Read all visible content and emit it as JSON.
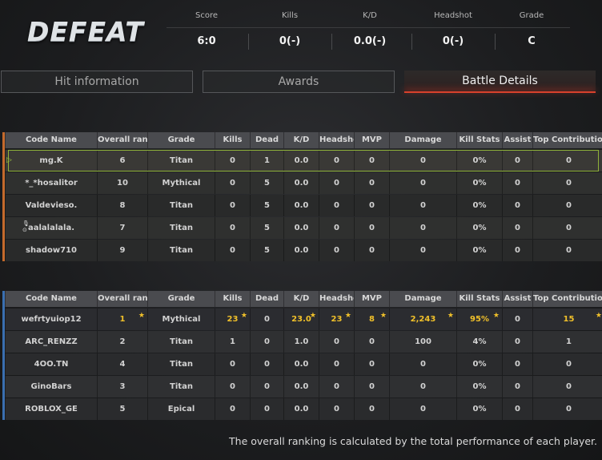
{
  "result": "DEFEAT",
  "summary": [
    {
      "label": "Score",
      "value": "6:0"
    },
    {
      "label": "Kills",
      "value": "0(-)"
    },
    {
      "label": "K/D",
      "value": "0.0(-)"
    },
    {
      "label": "Headshot",
      "value": "0(-)"
    },
    {
      "label": "Grade",
      "value": "C"
    }
  ],
  "tabs": [
    {
      "label": "Hit information",
      "active": false
    },
    {
      "label": "Awards",
      "active": false
    },
    {
      "label": "Battle Details",
      "active": true
    }
  ],
  "columns": [
    "Code Name",
    "Overall ranking",
    "Grade",
    "Kills",
    "Dead",
    "K/D",
    "Headshot",
    "MVP",
    "Damage",
    "Kill Stats",
    "Assist",
    "Top Contribution"
  ],
  "colors": {
    "team1": "#c46a2c",
    "team2": "#3a6fb0",
    "gold": "#f0c02a",
    "selected": "#8fb23a",
    "active_tab": "#d8412c"
  },
  "team1": [
    {
      "name": "mg.K",
      "rank": "6",
      "grade": "Titan",
      "kills": "0",
      "dead": "1",
      "kd": "0.0",
      "hs": "0",
      "mvp": "0",
      "damage": "0",
      "killstats": "0%",
      "assist": "0",
      "top": "0"
    },
    {
      "name": "*_*hosalitor",
      "rank": "10",
      "grade": "Mythical",
      "kills": "0",
      "dead": "5",
      "kd": "0.0",
      "hs": "0",
      "mvp": "0",
      "damage": "0",
      "killstats": "0%",
      "assist": "0",
      "top": "0"
    },
    {
      "name": "Valdevieso.",
      "rank": "8",
      "grade": "Titan",
      "kills": "0",
      "dead": "5",
      "kd": "0.0",
      "hs": "0",
      "mvp": "0",
      "damage": "0",
      "killstats": "0%",
      "assist": "0",
      "top": "0"
    },
    {
      "name": "aalalalala.",
      "rank": "7",
      "grade": "Titan",
      "kills": "0",
      "dead": "5",
      "kd": "0.0",
      "hs": "0",
      "mvp": "0",
      "damage": "0",
      "killstats": "0%",
      "assist": "0",
      "top": "0"
    },
    {
      "name": "shadow710",
      "rank": "9",
      "grade": "Titan",
      "kills": "0",
      "dead": "5",
      "kd": "0.0",
      "hs": "0",
      "mvp": "0",
      "damage": "0",
      "killstats": "0%",
      "assist": "0",
      "top": "0"
    }
  ],
  "team2": [
    {
      "name": "wefrtyuiop12",
      "rank": "1",
      "grade": "Mythical",
      "kills": "23",
      "dead": "0",
      "kd": "23.0",
      "hs": "23",
      "mvp": "8",
      "damage": "2,243",
      "killstats": "95%",
      "assist": "0",
      "top": "15"
    },
    {
      "name": "ARC_RENZZ",
      "rank": "2",
      "grade": "Titan",
      "kills": "1",
      "dead": "0",
      "kd": "1.0",
      "hs": "0",
      "mvp": "0",
      "damage": "100",
      "killstats": "4%",
      "assist": "0",
      "top": "1"
    },
    {
      "name": "4OO.TN",
      "rank": "4",
      "grade": "Titan",
      "kills": "0",
      "dead": "0",
      "kd": "0.0",
      "hs": "0",
      "mvp": "0",
      "damage": "0",
      "killstats": "0%",
      "assist": "0",
      "top": "0"
    },
    {
      "name": "GinoBars",
      "rank": "3",
      "grade": "Titan",
      "kills": "0",
      "dead": "0",
      "kd": "0.0",
      "hs": "0",
      "mvp": "0",
      "damage": "0",
      "killstats": "0%",
      "assist": "0",
      "top": "0"
    },
    {
      "name": "ROBLOX_GE",
      "rank": "5",
      "grade": "Epical",
      "kills": "0",
      "dead": "0",
      "kd": "0.0",
      "hs": "0",
      "mvp": "0",
      "damage": "0",
      "killstats": "0%",
      "assist": "0",
      "top": "0"
    }
  ],
  "footer": "The overall ranking is calculated by the total performance of each player."
}
